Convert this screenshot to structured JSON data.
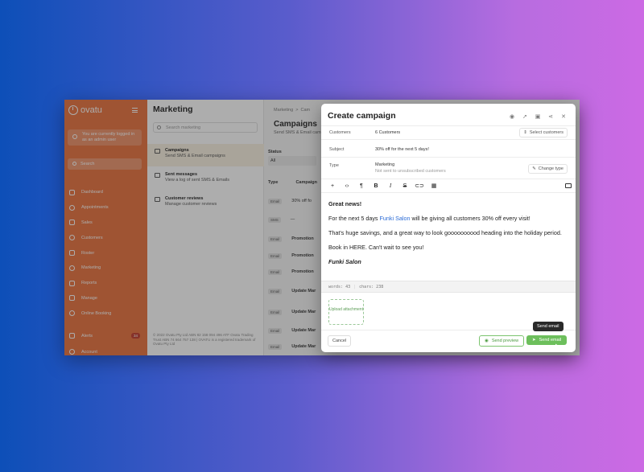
{
  "sidebar": {
    "brand": "ovatu",
    "admin_notice": "You are currently logged in as an admin user",
    "search_placeholder": "Search",
    "items": [
      {
        "label": "Dashboard",
        "icon": "home-icon"
      },
      {
        "label": "Appointments",
        "icon": "clock-icon"
      },
      {
        "label": "Sales",
        "icon": "tag-icon"
      },
      {
        "label": "Customers",
        "icon": "users-icon"
      },
      {
        "label": "Roster",
        "icon": "roster-icon"
      },
      {
        "label": "Marketing",
        "icon": "chat-icon"
      },
      {
        "label": "Reports",
        "icon": "reports-icon"
      },
      {
        "label": "Manage",
        "icon": "rocket-icon"
      },
      {
        "label": "Online Booking",
        "icon": "globe-icon"
      }
    ],
    "alerts_label": "Alerts",
    "alerts_count": "34",
    "account_label": "Account"
  },
  "marketing": {
    "title": "Marketing",
    "search_placeholder": "Search marketing",
    "items": [
      {
        "title": "Campaigns",
        "subtitle": "Send SMS & Email campaigns"
      },
      {
        "title": "Sent messages",
        "subtitle": "View a log of sent SMS & Emails"
      },
      {
        "title": "Customer reviews",
        "subtitle": "Manage customer reviews"
      }
    ],
    "footer": "© 2022 Ovatu Pty Ltd ABN 82 158 094 496 ATF Ovatu Trading Trust ABN 74 664 757 138 | OVATU is a registered trademark of Ovatu Pty Ltd"
  },
  "campaigns": {
    "breadcrumb_1": "Marketing",
    "breadcrumb_sep": ">",
    "breadcrumb_2": "Cam",
    "title": "Campaigns",
    "subtitle": "Send SMS & Email cam",
    "status_label": "Status",
    "status_value": "All",
    "col_type": "Type",
    "col_campaign": "Campaign",
    "rows": [
      {
        "type": "Email",
        "name": "30% off fo"
      },
      {
        "type": "SMS",
        "name": "—"
      },
      {
        "type": "Email",
        "name": "Promotion"
      },
      {
        "type": "Email",
        "name": "Promotion"
      },
      {
        "type": "Email",
        "name": "Promotion"
      },
      {
        "type": "Email",
        "name": "Update Mar"
      },
      {
        "type": "Email",
        "name": "Update Mar"
      },
      {
        "type": "Email",
        "name": "Update Mar"
      },
      {
        "type": "Email",
        "name": "Update Mar"
      }
    ]
  },
  "modal": {
    "title": "Create campaign",
    "customers_label": "Customers",
    "customers_value": "6 Customers",
    "select_customers": "Select customers",
    "subject_label": "Subject",
    "subject_value": "30% off for the next 5 days!",
    "type_label": "Type",
    "type_value": "Marketing",
    "type_note": "Not sent to unsubscribed customers",
    "change_type": "Change type",
    "body": {
      "greeting": "Great news!",
      "p1_before": "For the next 5 days ",
      "p1_link": "Funki Salon",
      "p1_after": " will be giving all customers 30% off every visit!",
      "p2": "That's huge savings, and a great way to look goooooooood heading into the holiday period.",
      "p3": "Book in HERE. Can't wait to see you!",
      "signature": "Funki Salon"
    },
    "words": "words: 43",
    "chars": "chars: 238",
    "upload_label": "Upload attachment",
    "cancel": "Cancel",
    "send_preview": "Send preview",
    "send_email": "Send email",
    "tooltip": "Send email"
  },
  "colors": {
    "sidebar": "#e8703a",
    "accent_green": "#6dbf5c",
    "link_blue": "#2b6bd6"
  }
}
